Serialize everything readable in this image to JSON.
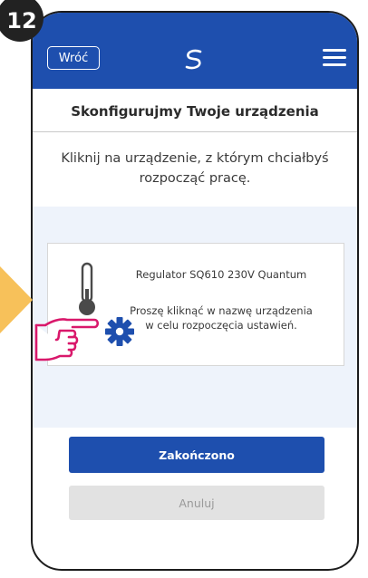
{
  "step": {
    "number": "12"
  },
  "header": {
    "back_label": "Wróć",
    "logo_icon": "s-logo-icon",
    "menu_icon": "hamburger-menu-icon",
    "bar_color": "#1e4fae"
  },
  "main": {
    "heading": "Skonfigurujmy Twoje urządzenia",
    "subtitle": "Kliknij na urządzenie, z którym chciałbyś rozpocząć pracę."
  },
  "device": {
    "name": "Regulator SQ610 230V Quantum",
    "hint": "Proszę kliknąć w nazwę urządzenia w celu rozpoczęcia ustawień.",
    "icons": [
      "thermometer-icon",
      "gear-icon"
    ]
  },
  "actions": {
    "done_label": "Zakończono",
    "cancel_label": "Anuluj"
  },
  "annotations": {
    "arrow_color": "#f7c15a",
    "hand_color": "#d9186b"
  }
}
